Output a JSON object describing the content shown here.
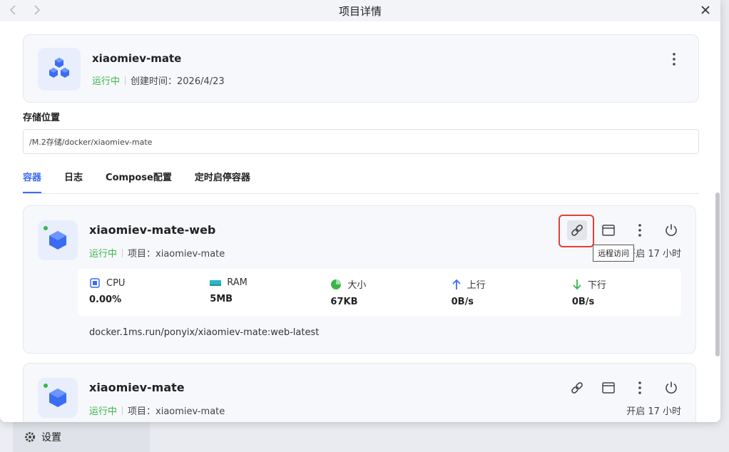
{
  "window": {
    "title": "项目详情"
  },
  "project": {
    "name": "xiaomiev-mate",
    "status": "运行中",
    "created": "创建时间：2026/4/23"
  },
  "storage": {
    "label": "存储位置",
    "path": "/M.2存储/docker/xiaomiev-mate"
  },
  "tabs": [
    {
      "label": "容器",
      "active": true
    },
    {
      "label": "日志",
      "active": false
    },
    {
      "label": "Compose配置",
      "active": false
    },
    {
      "label": "定时启停容器",
      "active": false
    }
  ],
  "containers": [
    {
      "name": "xiaomiev-mate-web",
      "status": "运行中",
      "project": "项目：xiaomiev-mate",
      "uptime": "开启 17 小时",
      "tooltip": "远程访问",
      "stats": [
        {
          "label": "CPU",
          "value": "0.00%",
          "icon": "cpu-icon"
        },
        {
          "label": "RAM",
          "value": "5MB",
          "icon": "ram-icon"
        },
        {
          "label": "大小",
          "value": "67KB",
          "icon": "pie-icon"
        },
        {
          "label": "上行",
          "value": "0B/s",
          "icon": "arrow-up-icon"
        },
        {
          "label": "下行",
          "value": "0B/s",
          "icon": "arrow-down-icon"
        }
      ],
      "image": "docker.1ms.run/ponyix/xiaomiev-mate:web-latest"
    },
    {
      "name": "xiaomiev-mate",
      "status": "运行中",
      "project": "项目：xiaomiev-mate",
      "uptime": "开启 17 小时"
    }
  ],
  "background": {
    "settings_label": "设置"
  },
  "colors": {
    "accent": "#3a6cf4",
    "running": "#3bb54a",
    "highlight": "#e0413b"
  }
}
